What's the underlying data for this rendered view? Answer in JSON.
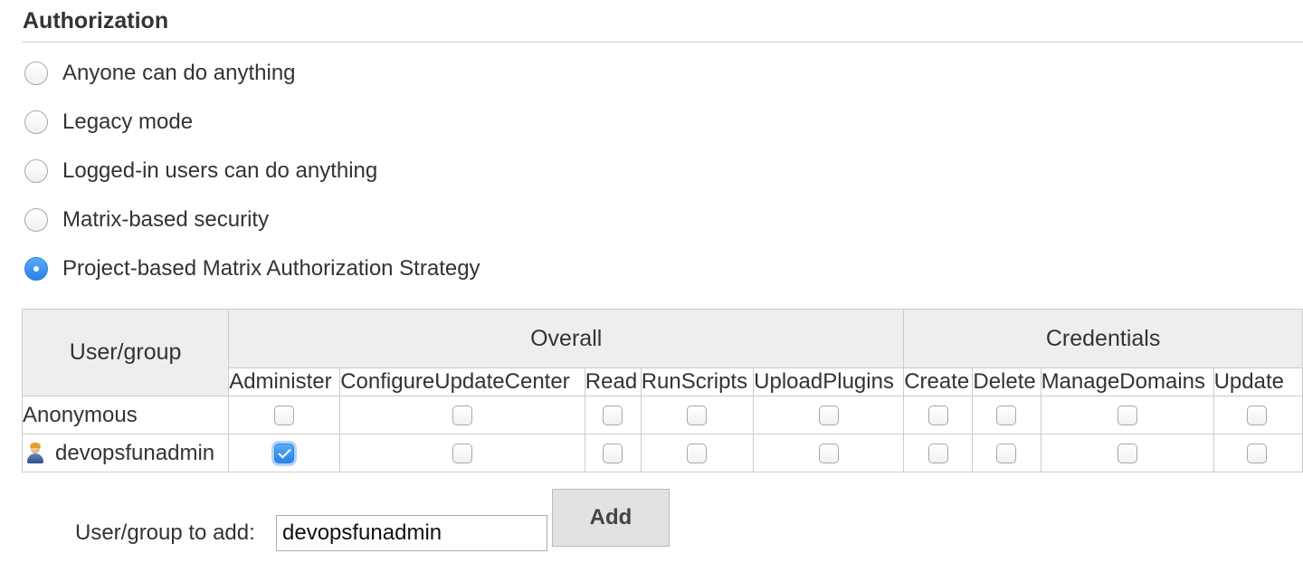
{
  "section": {
    "title": "Authorization"
  },
  "strategies": [
    {
      "label": "Anyone can do anything",
      "selected": false
    },
    {
      "label": "Legacy mode",
      "selected": false
    },
    {
      "label": "Logged-in users can do anything",
      "selected": false
    },
    {
      "label": "Matrix-based security",
      "selected": false
    },
    {
      "label": "Project-based Matrix Authorization Strategy",
      "selected": true
    }
  ],
  "matrix": {
    "user_group_header": "User/group",
    "groups": [
      {
        "name": "Overall",
        "permissions": [
          "Administer",
          "ConfigureUpdateCenter",
          "Read",
          "RunScripts",
          "UploadPlugins"
        ]
      },
      {
        "name": "Credentials",
        "permissions": [
          "Create",
          "Delete",
          "ManageDomains",
          "Update"
        ]
      }
    ],
    "rows": [
      {
        "name": "Anonymous",
        "icon": "user-icon",
        "has_icon": false,
        "checks": [
          false,
          false,
          false,
          false,
          false,
          false,
          false,
          false,
          false
        ]
      },
      {
        "name": "devopsfunadmin",
        "icon": "user-icon",
        "has_icon": true,
        "checks": [
          true,
          false,
          false,
          false,
          false,
          false,
          false,
          false,
          false
        ]
      }
    ]
  },
  "add_user": {
    "label": "User/group to add:",
    "value": "devopsfunadmin",
    "button_label": "Add"
  },
  "colors": {
    "accent": "#2a82e8",
    "border": "#cccccc",
    "header_bg": "#eeeeee"
  }
}
